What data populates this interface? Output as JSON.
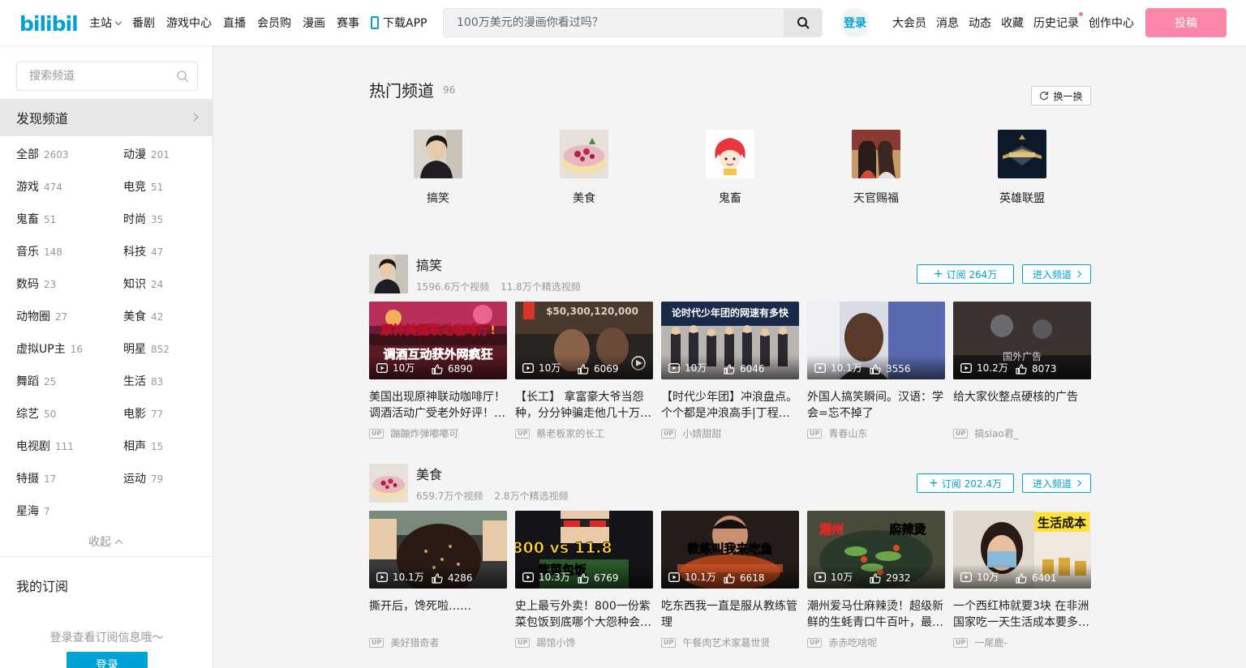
{
  "header": {
    "logo_text": "bilibili",
    "nav": [
      "主站",
      "番剧",
      "游戏中心",
      "直播",
      "会员购",
      "漫画",
      "赛事"
    ],
    "download_app": "下载APP",
    "search_placeholder": "100万美元的漫画你看过吗？",
    "login": "登录",
    "right_nav": [
      "大会员",
      "消息",
      "动态",
      "收藏",
      "历史记录",
      "创作中心"
    ],
    "upload": "投稿"
  },
  "sidebar": {
    "search_placeholder": "搜索频道",
    "discover": "发现频道",
    "categories": [
      {
        "name": "全部",
        "count": "2603"
      },
      {
        "name": "动漫",
        "count": "201"
      },
      {
        "name": "游戏",
        "count": "474"
      },
      {
        "name": "电竞",
        "count": "51"
      },
      {
        "name": "鬼畜",
        "count": "51"
      },
      {
        "name": "时尚",
        "count": "35"
      },
      {
        "name": "音乐",
        "count": "148"
      },
      {
        "name": "科技",
        "count": "47"
      },
      {
        "name": "数码",
        "count": "23"
      },
      {
        "name": "知识",
        "count": "24"
      },
      {
        "name": "动物圈",
        "count": "27"
      },
      {
        "name": "美食",
        "count": "42"
      },
      {
        "name": "虚拟UP主",
        "count": "16"
      },
      {
        "name": "明星",
        "count": "852"
      },
      {
        "name": "舞蹈",
        "count": "25"
      },
      {
        "name": "生活",
        "count": "83"
      },
      {
        "name": "综艺",
        "count": "50"
      },
      {
        "name": "电影",
        "count": "77"
      },
      {
        "name": "电视剧",
        "count": "111"
      },
      {
        "name": "相声",
        "count": "15"
      },
      {
        "name": "特摄",
        "count": "17"
      },
      {
        "name": "运动",
        "count": "79"
      },
      {
        "name": "星海",
        "count": "7"
      }
    ],
    "collapse": "收起",
    "my_subscriptions": "我的订阅",
    "login_tip": "登录查看订阅信息哦～",
    "login_button": "登录"
  },
  "hot": {
    "title": "热门频道",
    "count": "96",
    "refresh": "换一换",
    "items": [
      "搞笑",
      "美食",
      "鬼畜",
      "天官赐福",
      "英雄联盟"
    ]
  },
  "channels": [
    {
      "name": "搞笑",
      "videos_count": "1596.6万个视频",
      "featured_count": "11.8万个精选视频",
      "subscribe": "订阅 264万",
      "enter": "进入频道",
      "videos": [
        {
          "views": "10万",
          "likes": "6890",
          "title": "美国出现原神联动咖啡厅！调酒活动广受老外好评！…",
          "up": "蹦蹦炸弹嘟嘟可",
          "thumb_text": "原神美国联动咖啡厅!\n调酒互动获外网疯狂"
        },
        {
          "views": "10万",
          "likes": "6069",
          "title": "【长工】 拿富豪大爷当怨种，分分钟骗走他几十万…",
          "up": "蔡老板家的长工",
          "thumb_text": "$50,300,120,000"
        },
        {
          "views": "10万",
          "likes": "6046",
          "title": "【时代少年团】冲浪盘点。个个都是冲浪高手|丁程…",
          "up": "小婧甜甜",
          "thumb_text": "论时代少年团的网速有多快"
        },
        {
          "views": "10.1万",
          "likes": "3556",
          "title": "外国人搞笑瞬间。汉语：学会=忘不掉了",
          "up": "青春山东",
          "thumb_text": ""
        },
        {
          "views": "10.2万",
          "likes": "8073",
          "title": "给大家伙整点硬核的广告",
          "up": "搞siao君_",
          "thumb_text": "国外广告"
        }
      ]
    },
    {
      "name": "美食",
      "videos_count": "659.7万个视频",
      "featured_count": "2.8万个精选视频",
      "subscribe": "订阅 202.4万",
      "enter": "进入频道",
      "videos": [
        {
          "views": "10.1万",
          "likes": "4286",
          "title": "撕开后，馋死啦……",
          "up": "美好猎奇者",
          "thumb_text": ""
        },
        {
          "views": "10.3万",
          "likes": "6769",
          "title": "史上最亏外卖！800一份紫菜包饭到底哪个大怨种会…",
          "up": "踢馆小馋",
          "thumb_text": "800 vs 11.8\n紫菜包饭"
        },
        {
          "views": "10.1万",
          "likes": "6618",
          "title": "吃东西我一直是服从教练管理",
          "up": "午餐肉艺术家葛世贤",
          "thumb_text": "教练叫我来吃鱼"
        },
        {
          "views": "10万",
          "likes": "2932",
          "title": "潮州爱马仕麻辣烫！超级新鲜的生蚝青口牛百叶，最…",
          "up": "赤赤吃啥呢",
          "thumb_text": "潮州  麻辣烫"
        },
        {
          "views": "10万",
          "likes": "6401",
          "title": "一个西红柿就要3块 在非洲国家吃一天生活成本要多…",
          "up": "一尾鹿-",
          "thumb_text": "生活成本"
        }
      ]
    }
  ],
  "colors": {
    "accent": "#00a1d6",
    "pink": "#fb7299",
    "bg": "#f4f4f4"
  }
}
